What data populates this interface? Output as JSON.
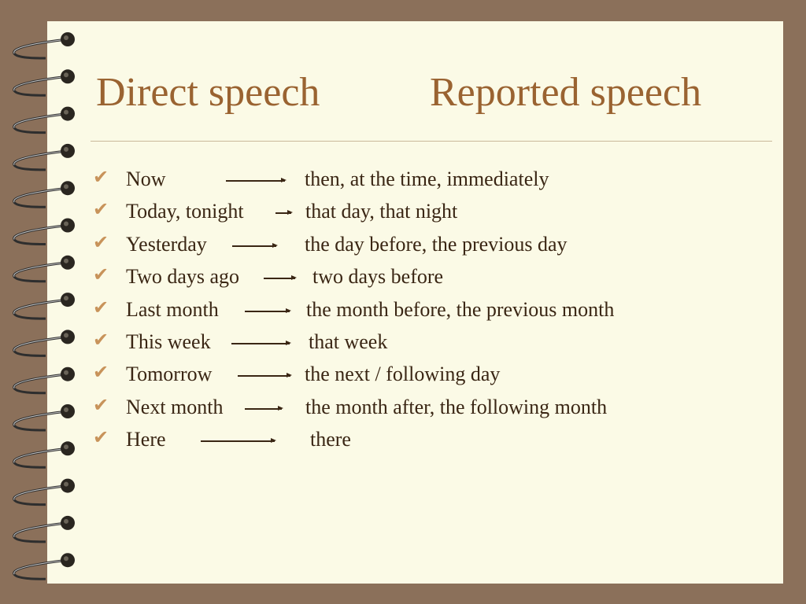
{
  "colors": {
    "background": "#8b705a",
    "page": "#fbfae6",
    "title": "#9a6331",
    "text": "#3a2614",
    "checkmark": "#c8935a"
  },
  "header": {
    "left_title": "Direct speech",
    "right_title": "Reported speech"
  },
  "bullet_icon": "checkmark-icon",
  "rows": [
    {
      "direct": "Now",
      "reported": "then, at the time, immediately"
    },
    {
      "direct": "Today, tonight",
      "reported": "that day, that night"
    },
    {
      "direct": "Yesterday",
      "reported": "the day before, the previous day"
    },
    {
      "direct": "Two days ago",
      "reported": "two days before"
    },
    {
      "direct": "Last month",
      "reported": "the month before, the previous month"
    },
    {
      "direct": "This week",
      "reported": "that week"
    },
    {
      "direct": "Tomorrow",
      "reported": "the next / following day"
    },
    {
      "direct": "Next month",
      "reported": "the month after, the following month"
    },
    {
      "direct": "Here",
      "reported": "there"
    }
  ]
}
